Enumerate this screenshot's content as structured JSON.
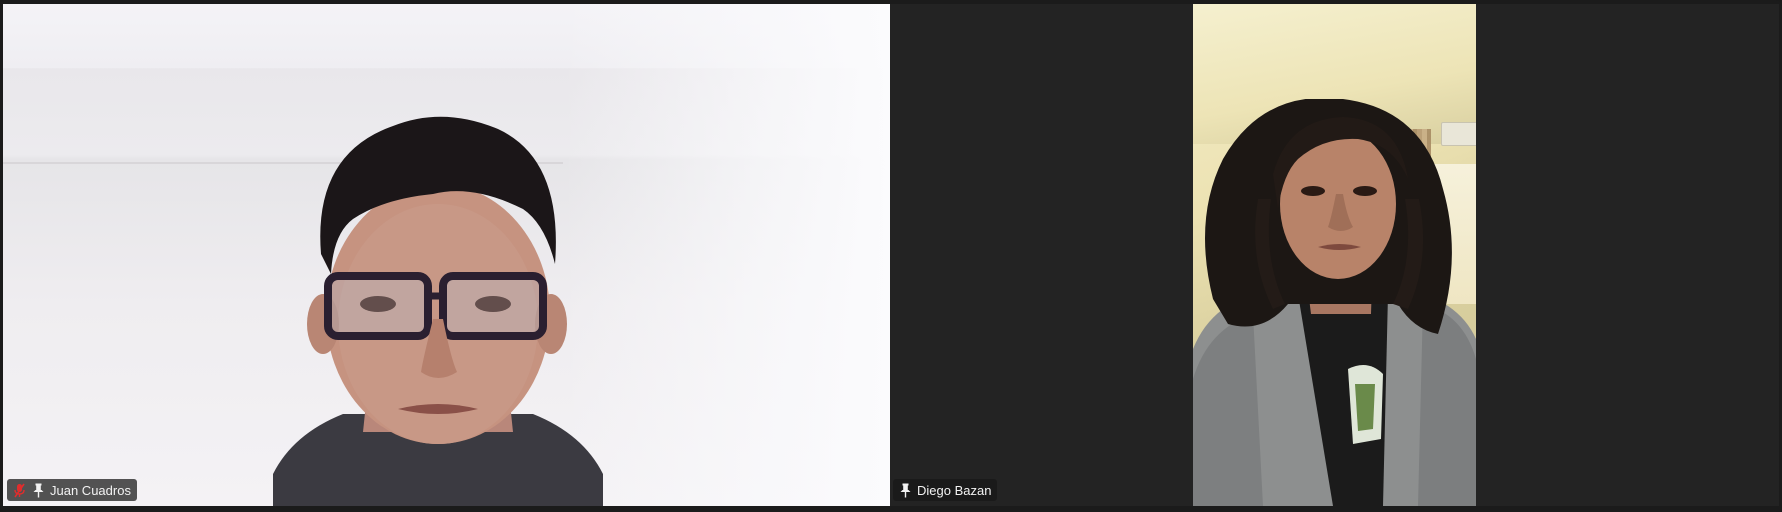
{
  "participants": [
    {
      "name": "Juan Cuadros",
      "muted": true,
      "pinned": true
    },
    {
      "name": "Diego Bazan",
      "muted": false,
      "pinned": true
    }
  ],
  "icons": {
    "muted": "mic-muted-icon",
    "pinned": "pin-icon"
  },
  "colors": {
    "muted_icon": "#e02d2d",
    "label_text": "#f2f2f2",
    "background": "#232323"
  }
}
